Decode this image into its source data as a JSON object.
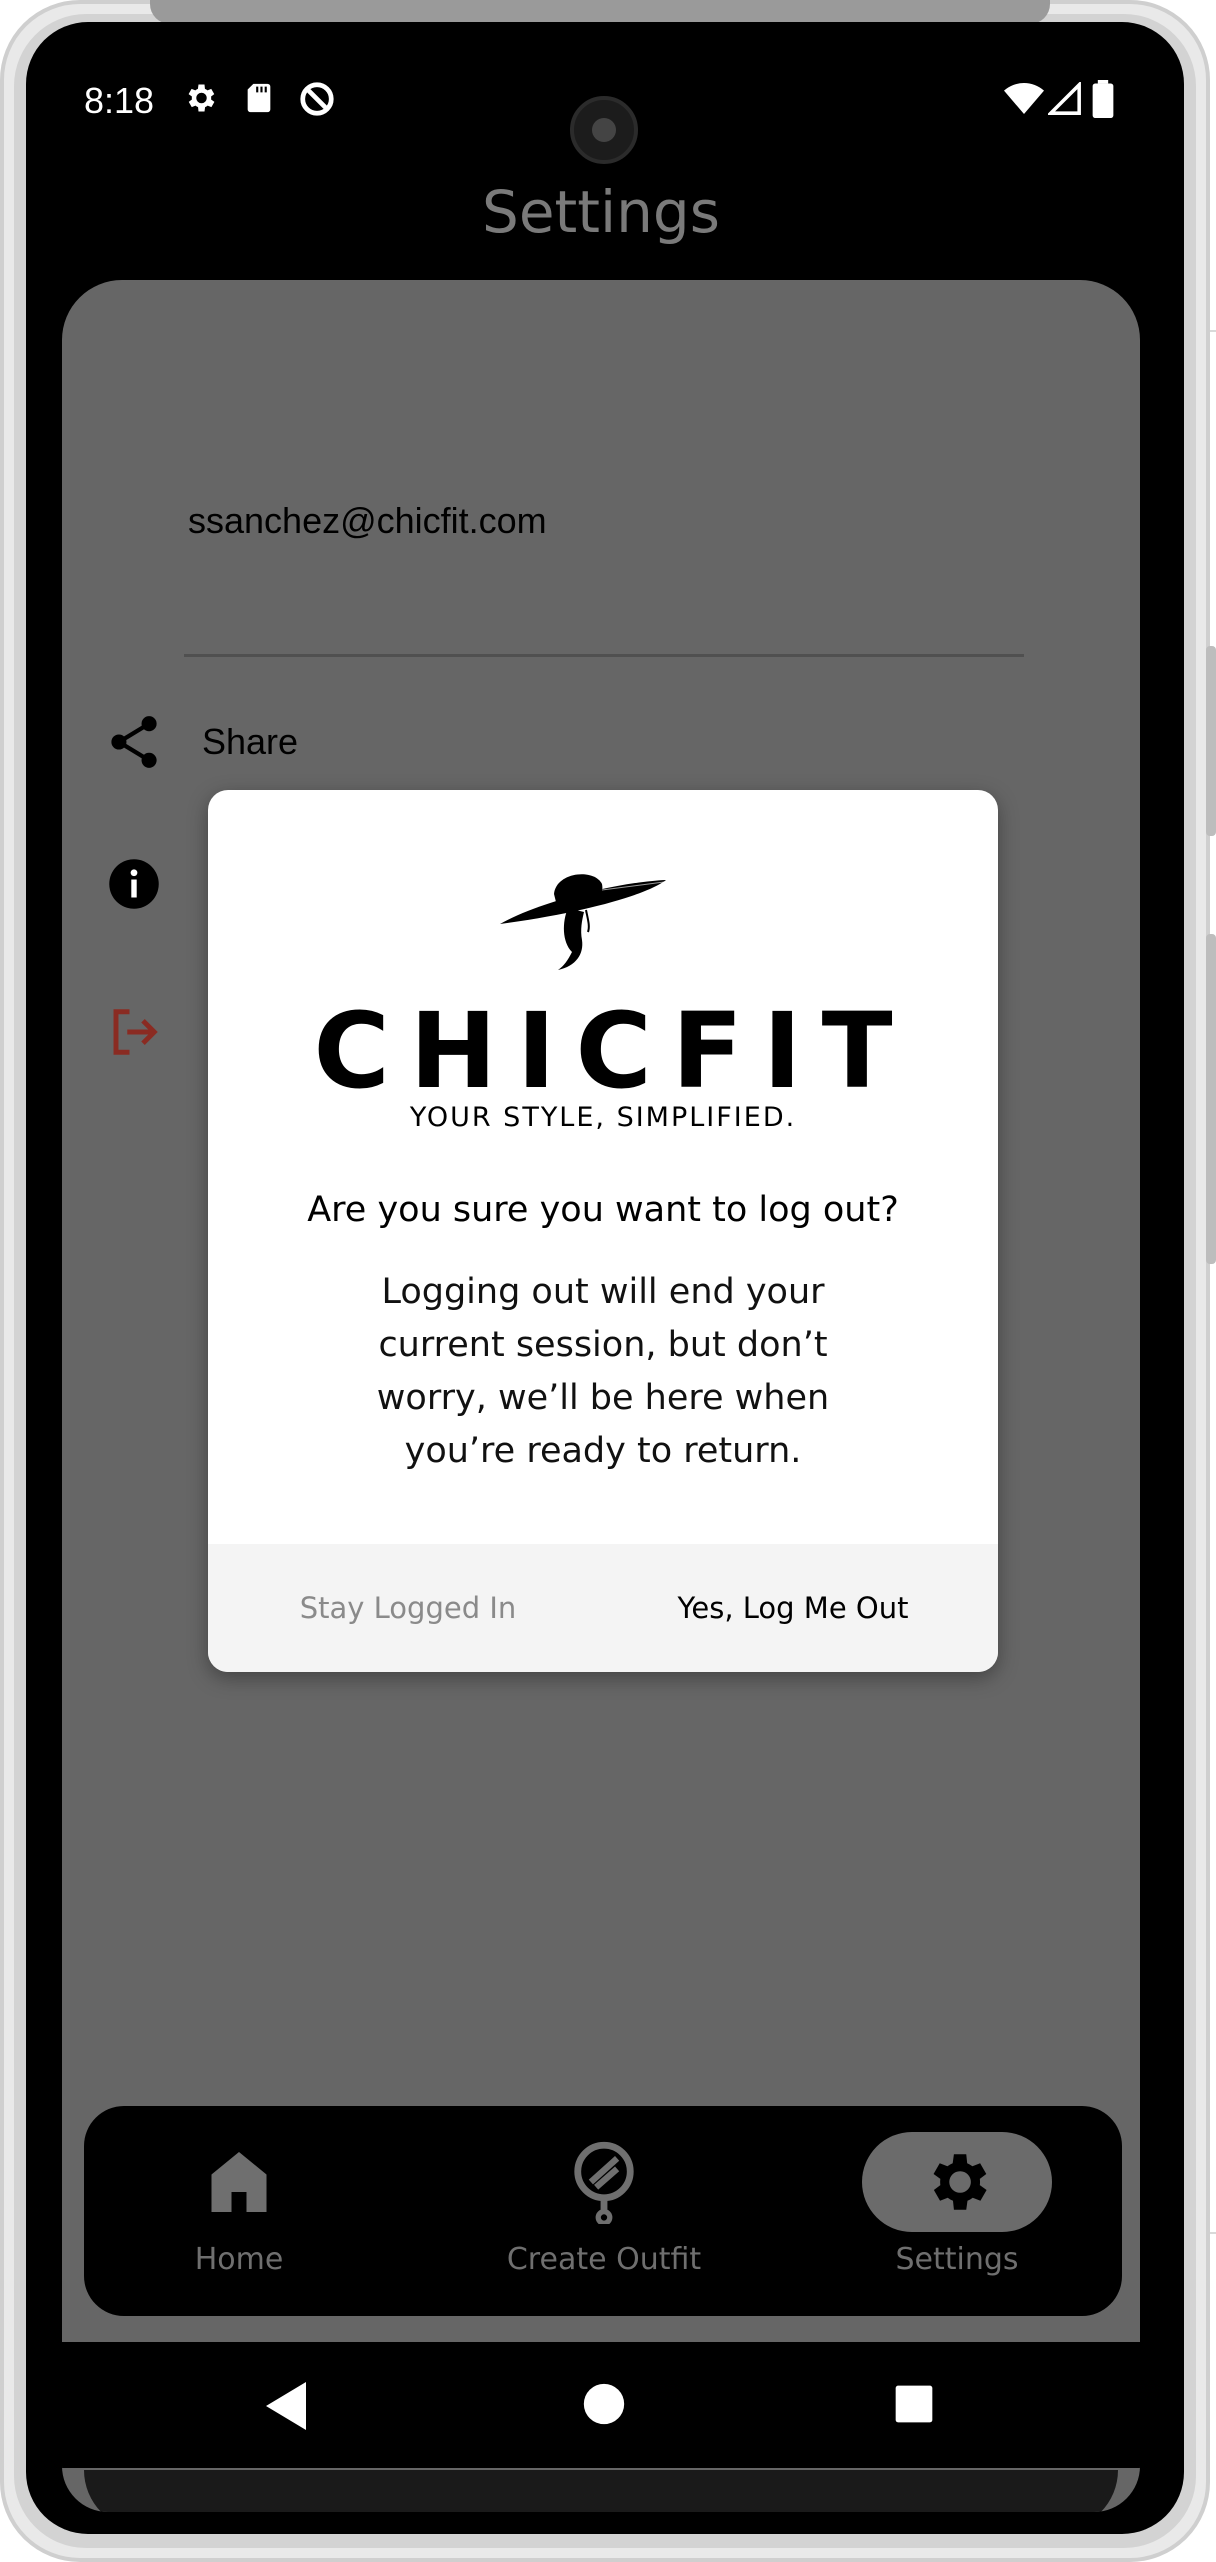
{
  "status_bar": {
    "time": "8:18",
    "left_icons": [
      "gear-icon",
      "sd-card-icon",
      "data-saver-icon"
    ],
    "right_icons": [
      "wifi-icon",
      "cell-signal-icon",
      "battery-icon"
    ]
  },
  "header": {
    "title": "Settings"
  },
  "settings": {
    "email": "ssanchez@chicfit.com",
    "items": [
      {
        "icon": "share-icon",
        "label": "Share"
      },
      {
        "icon": "info-icon",
        "label": ""
      },
      {
        "icon": "logout-icon",
        "label": "",
        "color": "#8a2b22"
      }
    ]
  },
  "dialog": {
    "brand": "CHICFIT",
    "tagline": "YOUR STYLE, SIMPLIFIED.",
    "question": "Are you sure you want to log out?",
    "message": "Logging out will end your current session, but don’t worry, we’ll be here when you’re ready to return.",
    "cancel_label": "Stay Logged In",
    "confirm_label": "Yes, Log Me Out"
  },
  "bottom_nav": {
    "items": [
      {
        "icon": "home-icon",
        "label": "Home",
        "active": false
      },
      {
        "icon": "mirror-icon",
        "label": "Create Outfit",
        "active": false
      },
      {
        "icon": "gear-icon",
        "label": "Settings",
        "active": true
      }
    ]
  },
  "system_nav": [
    "back-icon",
    "home-circle-icon",
    "recents-icon"
  ],
  "colors": {
    "overlay": "#666666",
    "logout_red": "#8a2b22",
    "nav_inactive": "#6f6f6f",
    "active_pill": "#6b6b6b"
  }
}
